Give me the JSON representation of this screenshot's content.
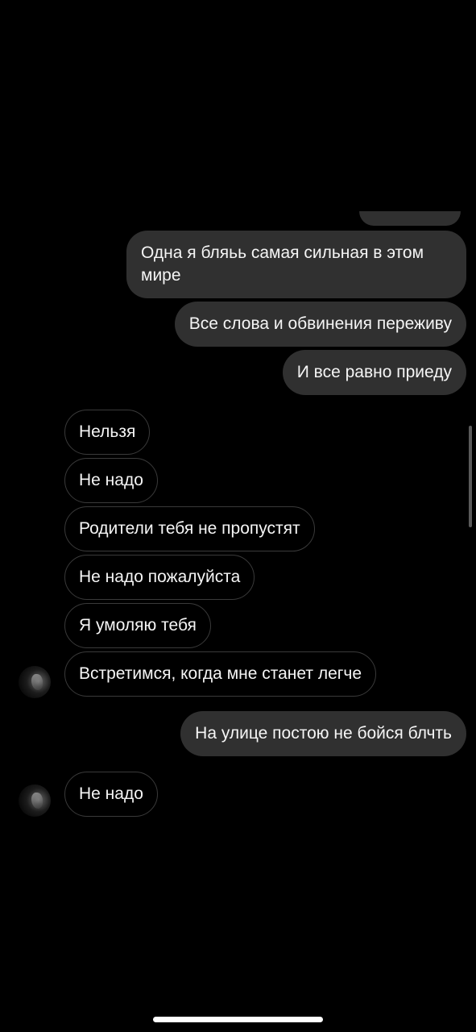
{
  "messages": [
    {
      "direction": "outgoing",
      "text": "Одна я бляьь самая сильная в этом мире"
    },
    {
      "direction": "outgoing",
      "text": "Все слова и обвинения переживу"
    },
    {
      "direction": "outgoing",
      "text": "И все равно приеду"
    },
    {
      "direction": "incoming",
      "text": "Нельзя"
    },
    {
      "direction": "incoming",
      "text": "Не надо"
    },
    {
      "direction": "incoming",
      "text": "Родители тебя не пропустят"
    },
    {
      "direction": "incoming",
      "text": "Не надо пожалуйста"
    },
    {
      "direction": "incoming",
      "text": "Я умоляю тебя"
    },
    {
      "direction": "incoming",
      "text": "Встретимся, когда мне станет легче"
    },
    {
      "direction": "outgoing",
      "text": "На улице постою не бойся блчть"
    },
    {
      "direction": "incoming",
      "text": "Не надо"
    }
  ],
  "colors": {
    "background": "#000000",
    "outgoing_bubble": "#303030",
    "incoming_border": "#3a3a3a",
    "text": "#f5f5f5"
  },
  "icons": {
    "avatar": "contact-avatar"
  }
}
